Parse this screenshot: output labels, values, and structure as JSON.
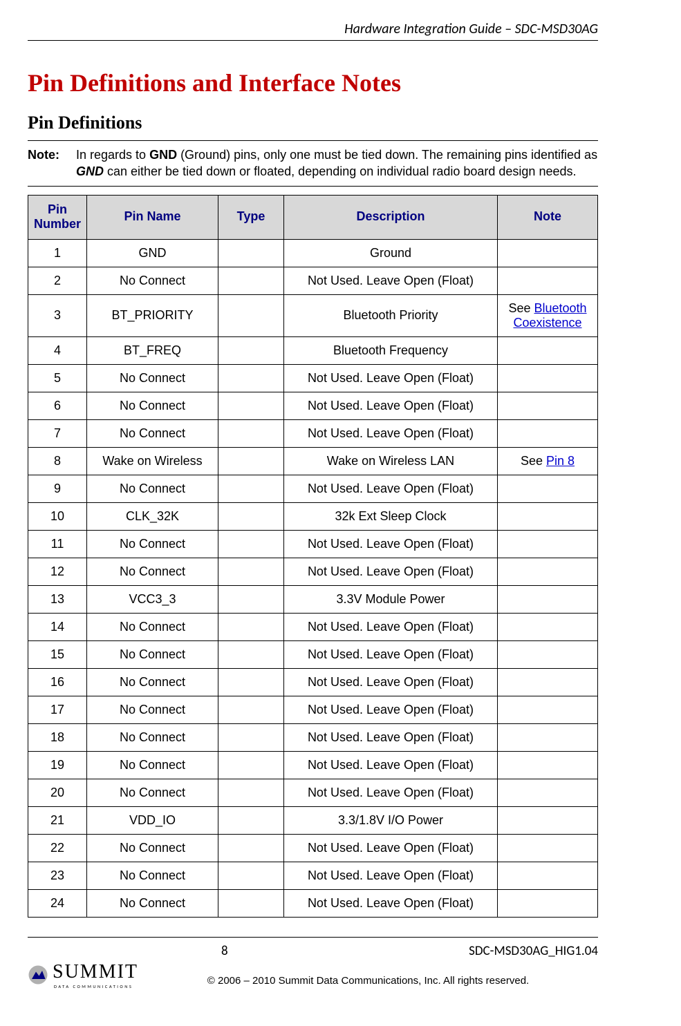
{
  "header": {
    "doc_title": "Hardware Integration Guide – SDC-MSD30AG"
  },
  "titles": {
    "h1": "Pin Definitions and Interface Notes",
    "h2": "Pin Definitions"
  },
  "note": {
    "label": "Note:",
    "prefix": "In regards to ",
    "bold1": "GND",
    "mid": " (Ground) pins, only one must be tied down. The remaining pins identified as ",
    "bold2": "GND",
    "suffix": " can either be tied down or floated, depending on individual radio board design needs."
  },
  "columns": {
    "num": "Pin Number",
    "name": "Pin Name",
    "type": "Type",
    "desc": "Description",
    "note": "Note"
  },
  "links": {
    "bt_coex_pre": "See ",
    "bt_coex": "Bluetooth Coexistence",
    "pin8_pre": "See ",
    "pin8": "Pin 8"
  },
  "rows": [
    {
      "num": "1",
      "name": "GND",
      "type": "",
      "desc": "Ground",
      "note": ""
    },
    {
      "num": "2",
      "name": "No Connect",
      "type": "",
      "desc": "Not Used. Leave Open (Float)",
      "note": ""
    },
    {
      "num": "3",
      "name": "BT_PRIORITY",
      "type": "",
      "desc": "Bluetooth Priority",
      "note": "__LINK_BT__"
    },
    {
      "num": "4",
      "name": "BT_FREQ",
      "type": "",
      "desc": "Bluetooth Frequency",
      "note": ""
    },
    {
      "num": "5",
      "name": "No Connect",
      "type": "",
      "desc": "Not Used. Leave Open (Float)",
      "note": ""
    },
    {
      "num": "6",
      "name": "No Connect",
      "type": "",
      "desc": "Not Used. Leave Open (Float)",
      "note": ""
    },
    {
      "num": "7",
      "name": "No Connect",
      "type": "",
      "desc": "Not Used. Leave Open (Float)",
      "note": ""
    },
    {
      "num": "8",
      "name": "Wake on Wireless",
      "type": "",
      "desc": "Wake on Wireless LAN",
      "note": "__LINK_PIN8__"
    },
    {
      "num": "9",
      "name": "No Connect",
      "type": "",
      "desc": "Not Used. Leave Open (Float)",
      "note": ""
    },
    {
      "num": "10",
      "name": "CLK_32K",
      "type": "",
      "desc": "32k Ext Sleep Clock",
      "note": ""
    },
    {
      "num": "11",
      "name": "No Connect",
      "type": "",
      "desc": "Not Used. Leave Open (Float)",
      "note": ""
    },
    {
      "num": "12",
      "name": "No Connect",
      "type": "",
      "desc": "Not Used. Leave Open (Float)",
      "note": ""
    },
    {
      "num": "13",
      "name": "VCC3_3",
      "type": "",
      "desc": "3.3V Module Power",
      "note": ""
    },
    {
      "num": "14",
      "name": "No Connect",
      "type": "",
      "desc": "Not Used. Leave Open (Float)",
      "note": ""
    },
    {
      "num": "15",
      "name": "No Connect",
      "type": "",
      "desc": "Not Used. Leave Open (Float)",
      "note": ""
    },
    {
      "num": "16",
      "name": "No Connect",
      "type": "",
      "desc": "Not Used. Leave Open (Float)",
      "note": ""
    },
    {
      "num": "17",
      "name": "No Connect",
      "type": "",
      "desc": "Not Used. Leave Open (Float)",
      "note": ""
    },
    {
      "num": "18",
      "name": "No Connect",
      "type": "",
      "desc": "Not Used. Leave Open (Float)",
      "note": ""
    },
    {
      "num": "19",
      "name": "No Connect",
      "type": "",
      "desc": "Not Used. Leave Open (Float)",
      "note": ""
    },
    {
      "num": "20",
      "name": "No Connect",
      "type": "",
      "desc": "Not Used. Leave Open (Float)",
      "note": ""
    },
    {
      "num": "21",
      "name": "VDD_IO",
      "type": "",
      "desc": "3.3/1.8V I/O Power",
      "note": ""
    },
    {
      "num": "22",
      "name": "No Connect",
      "type": "",
      "desc": "Not Used. Leave Open (Float)",
      "note": ""
    },
    {
      "num": "23",
      "name": "No Connect",
      "type": "",
      "desc": "Not Used. Leave Open (Float)",
      "note": ""
    },
    {
      "num": "24",
      "name": "No Connect",
      "type": "",
      "desc": "Not Used. Leave Open (Float)",
      "note": ""
    }
  ],
  "footer": {
    "page_no": "8",
    "doc_id": "SDC-MSD30AG_HIG1.04",
    "logo_name": "SUMMIT",
    "logo_tag": "DATA COMMUNICATIONS",
    "copyright": "© 2006 – 2010 Summit Data Communications, Inc. All rights reserved."
  }
}
